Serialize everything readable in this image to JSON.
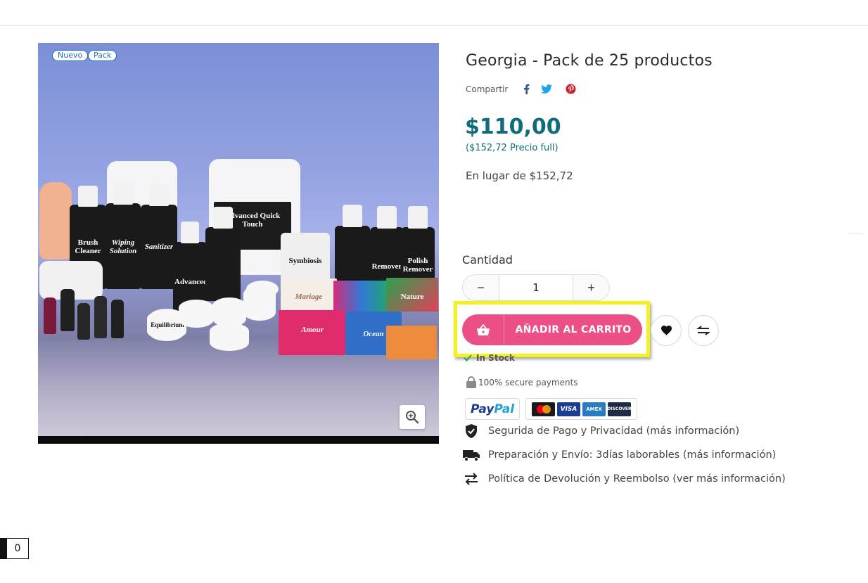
{
  "product": {
    "title": "Georgia - Pack de 25 productos",
    "badges": [
      "Nuevo",
      "Pack"
    ],
    "share_label": "Compartir",
    "social_icons": [
      "facebook-icon",
      "twitter-icon",
      "pinterest-icon"
    ],
    "price": "$110,00",
    "full_price": "($152,72 Precio full)",
    "instead_of": "En lugar de $152,72",
    "image_labels": [
      "Brush Cleaner",
      "Wiping Solution",
      "Sanitizer",
      "Advanced",
      "Advanced Quick Touch",
      "Symbiosis",
      "Polish Remover",
      "Remover",
      "Mariage",
      "Amour",
      "Ocean",
      "Nature",
      "Equilibrium"
    ]
  },
  "quantity": {
    "label": "Cantidad",
    "value": "1",
    "minus": "−",
    "plus": "+"
  },
  "cart": {
    "add_label": "AÑADIR AL CARRITO"
  },
  "availability": {
    "stock": "In Stock",
    "secure": "100% secure payments"
  },
  "payments": {
    "paypal_part1": "Pay",
    "paypal_part2": "Pal",
    "cards": [
      "mastercard",
      "VISA",
      "AMEX",
      "DISCOVER"
    ]
  },
  "info": [
    {
      "icon": "shield-check-icon",
      "text": "Segurida de Pago y Privacidad (más información)"
    },
    {
      "icon": "truck-icon",
      "text": "Preparación y Envío: 3días laborables (más información)"
    },
    {
      "icon": "exchange-icon",
      "text": "Política de Devolución y Reembolso (ver más información)"
    }
  ],
  "counter": {
    "value": "0"
  },
  "colors": {
    "price": "#106c7c",
    "cart_button": "#ec4f88",
    "highlight": "#f5f01f",
    "badge": "#1e6fb8"
  }
}
